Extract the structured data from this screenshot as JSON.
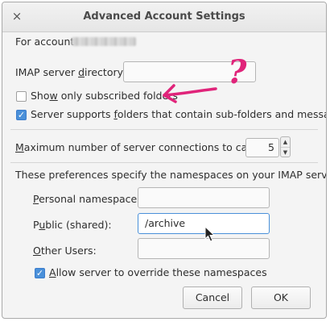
{
  "window": {
    "title": "Advanced Account Settings",
    "close_glyph": "×"
  },
  "account": {
    "label": "For account"
  },
  "imap_dir": {
    "label_pre": "IMAP server ",
    "label_access": "d",
    "label_post": "irectory:",
    "value": ""
  },
  "show_subscribed": {
    "label_pre": "Sho",
    "label_access": "w",
    "label_post": " only subscribed folders",
    "checked": false
  },
  "subfolders": {
    "label_pre": "Server supports ",
    "label_access": "f",
    "label_post": "olders that contain sub-folders and messages",
    "checked": true,
    "check_glyph": "✓"
  },
  "max_connections": {
    "label_access": "M",
    "label_post": "aximum number of server connections to cache",
    "value": "5",
    "up_glyph": "▲",
    "down_glyph": "▼"
  },
  "namespaces": {
    "heading": "These preferences specify the namespaces on your IMAP server",
    "personal": {
      "label_access": "P",
      "label_post": "ersonal namespace:",
      "value": ""
    },
    "public": {
      "label_pre": "P",
      "label_access": "u",
      "label_post": "blic (shared):",
      "value": "/archive"
    },
    "other": {
      "label_access": "O",
      "label_post": "ther Users:",
      "value": ""
    },
    "allow_override": {
      "label_access": "A",
      "label_post": "llow server to override these namespaces",
      "checked": true,
      "check_glyph": "✓"
    }
  },
  "buttons": {
    "cancel": "Cancel",
    "ok": "OK"
  },
  "annotation": {
    "mark": "?",
    "color": "#e0247a"
  },
  "colors": {
    "accent": "#4a90d9",
    "annotation": "#e0247a"
  },
  "icons": {
    "close": "close-icon",
    "cursor": "mouse-pointer-icon",
    "annotation_arrow": "arrow-left-icon"
  }
}
